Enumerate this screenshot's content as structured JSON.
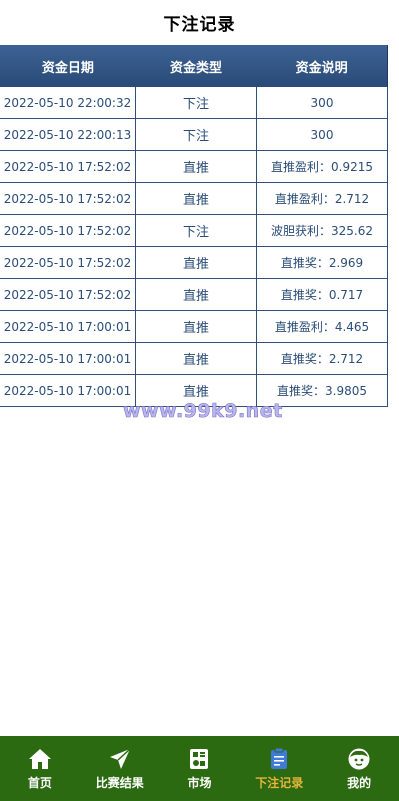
{
  "header": {
    "title": "下注记录"
  },
  "table": {
    "columns": [
      "资金日期",
      "资金类型",
      "资金说明"
    ],
    "rows": [
      [
        "2022-05-10 22:00:32",
        "下注",
        "300"
      ],
      [
        "2022-05-10 22:00:13",
        "下注",
        "300"
      ],
      [
        "2022-05-10 17:52:02",
        "直推",
        "直推盈利：0.9215"
      ],
      [
        "2022-05-10 17:52:02",
        "直推",
        "直推盈利：2.712"
      ],
      [
        "2022-05-10 17:52:02",
        "下注",
        "波胆获利：325.62"
      ],
      [
        "2022-05-10 17:52:02",
        "直推",
        "直推奖：2.969"
      ],
      [
        "2022-05-10 17:52:02",
        "直推",
        "直推奖：0.717"
      ],
      [
        "2022-05-10 17:00:01",
        "直推",
        "直推盈利：4.465"
      ],
      [
        "2022-05-10 17:00:01",
        "直推",
        "直推奖：2.712"
      ],
      [
        "2022-05-10 17:00:01",
        "直推",
        "直推奖：3.9805"
      ]
    ]
  },
  "watermark": "www.99k9.net",
  "tabbar": {
    "items": [
      {
        "label": "首页",
        "icon": "home-icon"
      },
      {
        "label": "比赛结果",
        "icon": "send-icon"
      },
      {
        "label": "市场",
        "icon": "market-icon"
      },
      {
        "label": "下注记录",
        "icon": "clipboard-icon",
        "active": true
      },
      {
        "label": "我的",
        "icon": "face-icon"
      }
    ],
    "active_color": "#e8b43a",
    "background": "#2b6a11"
  }
}
